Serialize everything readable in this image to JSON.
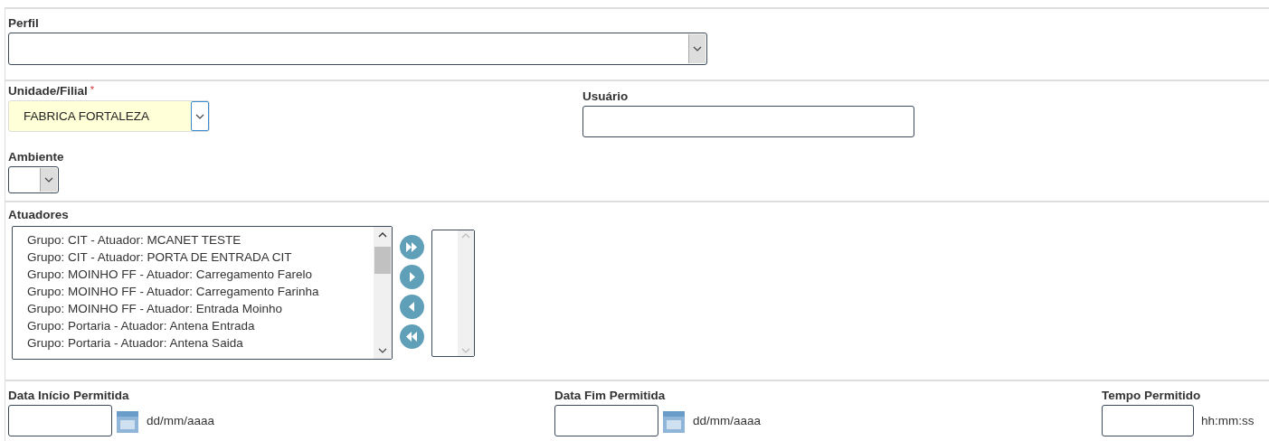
{
  "perfil": {
    "label": "Perfil"
  },
  "unidade": {
    "label": "Unidade/Filial",
    "required_mark": "*",
    "value": "FABRICA FORTALEZA"
  },
  "usuario": {
    "label": "Usuário"
  },
  "ambiente": {
    "label": "Ambiente"
  },
  "atuadores": {
    "label": "Atuadores",
    "options": [
      "Grupo: CIT - Atuador: MCANET TESTE",
      "Grupo: CIT - Atuador: PORTA DE ENTRADA CIT",
      "Grupo: MOINHO FF - Atuador: Carregamento Farelo",
      "Grupo: MOINHO FF - Atuador: Carregamento Farinha",
      "Grupo: MOINHO FF - Atuador: Entrada Moinho",
      "Grupo: Portaria - Atuador: Antena Entrada",
      "Grupo: Portaria - Atuador: Antena Saida"
    ]
  },
  "periodo": [
    {
      "kind": "date",
      "label": "Data Início Permitida",
      "format": "dd/mm/aaaa"
    },
    {
      "kind": "date",
      "label": "Data Fim Permitida",
      "format": "dd/mm/aaaa"
    },
    {
      "kind": "time",
      "label": "Tempo Permitido",
      "format": "hh:mm:ss"
    }
  ]
}
